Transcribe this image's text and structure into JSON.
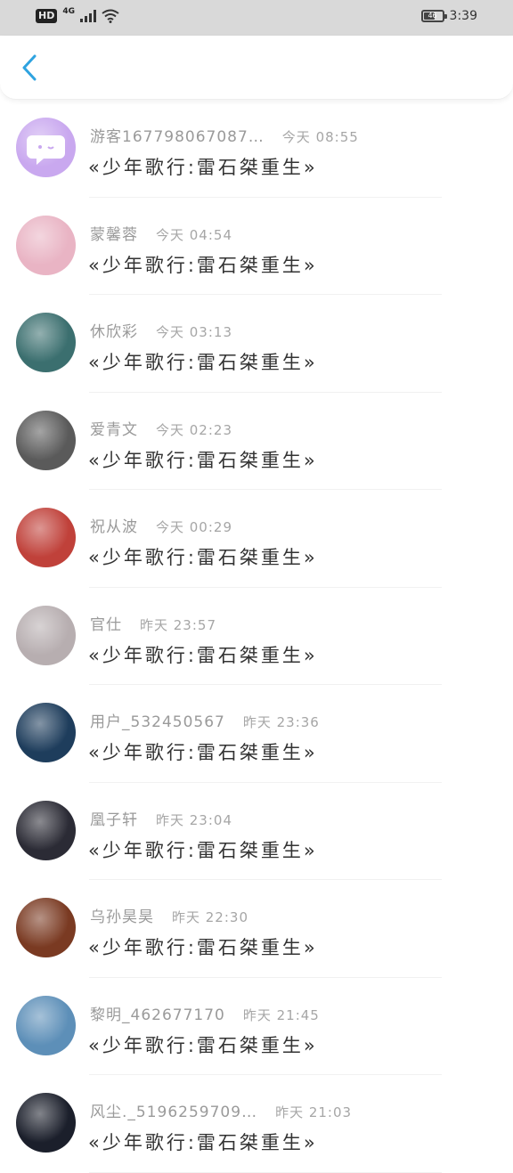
{
  "status_bar": {
    "hd": "HD",
    "network": "4G",
    "battery": "46",
    "time": "3:39"
  },
  "comments": [
    {
      "name": "游客167798067087…",
      "time": "今天 08:55",
      "title": "«少年歌行:雷石桀重生»",
      "avatar_color": "#c9a8ef"
    },
    {
      "name": "蒙馨蓉",
      "time": "今天 04:54",
      "title": "«少年歌行:雷石桀重生»",
      "avatar_color": "#e9b4c4"
    },
    {
      "name": "休欣彩",
      "time": "今天 03:13",
      "title": "«少年歌行:雷石桀重生»",
      "avatar_color": "#3b6f6f"
    },
    {
      "name": "爱青文",
      "time": "今天 02:23",
      "title": "«少年歌行:雷石桀重生»",
      "avatar_color": "#5a5a5a"
    },
    {
      "name": "祝从波",
      "time": "今天 00:29",
      "title": "«少年歌行:雷石桀重生»",
      "avatar_color": "#c0413a"
    },
    {
      "name": "官仕",
      "time": "昨天 23:57",
      "title": "«少年歌行:雷石桀重生»",
      "avatar_color": "#b7aeb0"
    },
    {
      "name": "用户_532450567",
      "time": "昨天 23:36",
      "title": "«少年歌行:雷石桀重生»",
      "avatar_color": "#1e3d5c"
    },
    {
      "name": "凰子轩",
      "time": "昨天 23:04",
      "title": "«少年歌行:雷石桀重生»",
      "avatar_color": "#2b2b35"
    },
    {
      "name": "乌孙昊昊",
      "time": "昨天 22:30",
      "title": "«少年歌行:雷石桀重生»",
      "avatar_color": "#7a3a22"
    },
    {
      "name": "黎明_462677170",
      "time": "昨天 21:45",
      "title": "«少年歌行:雷石桀重生»",
      "avatar_color": "#5d8fb8"
    },
    {
      "name": "风尘._5196259709…",
      "time": "昨天 21:03",
      "title": "«少年歌行:雷石桀重生»",
      "avatar_color": "#1b1f2b"
    }
  ],
  "colors": {
    "accent": "#2ea3e0",
    "status_bar_bg": "#d9d9d9"
  }
}
